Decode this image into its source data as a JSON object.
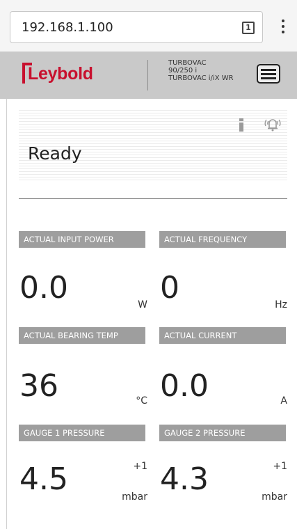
{
  "browser": {
    "url": "192.168.1.100",
    "tab_count": "1",
    "menu_icon": "more-vert-icon"
  },
  "header": {
    "logo_text": "Leybold",
    "brand_color": "#c8102e",
    "product_line1": "TURBOVAC",
    "product_line2": "90/250 i",
    "product_line3": "TURBOVAC i/iX WR",
    "menu_icon": "hamburger-menu-icon"
  },
  "status": {
    "text": "Ready",
    "info_icon": "info-icon",
    "alarm_icon": "alarm-bell-icon"
  },
  "metrics": {
    "input_power": {
      "label": "ACTUAL INPUT POWER",
      "value": "0.0",
      "unit": "W"
    },
    "frequency": {
      "label": "ACTUAL FREQUENCY",
      "value": "0",
      "unit": "Hz"
    },
    "bearing_temp": {
      "label": "ACTUAL BEARING TEMP",
      "value": "36",
      "unit": "°C"
    },
    "current": {
      "label": "ACTUAL CURRENT",
      "value": "0.0",
      "unit": "A"
    },
    "gauge1": {
      "label": "GAUGE 1 PRESSURE",
      "value": "4.5",
      "exponent": "+1",
      "unit": "mbar"
    },
    "gauge2": {
      "label": "GAUGE 2 PRESSURE",
      "value": "4.3",
      "exponent": "+1",
      "unit": "mbar"
    }
  }
}
